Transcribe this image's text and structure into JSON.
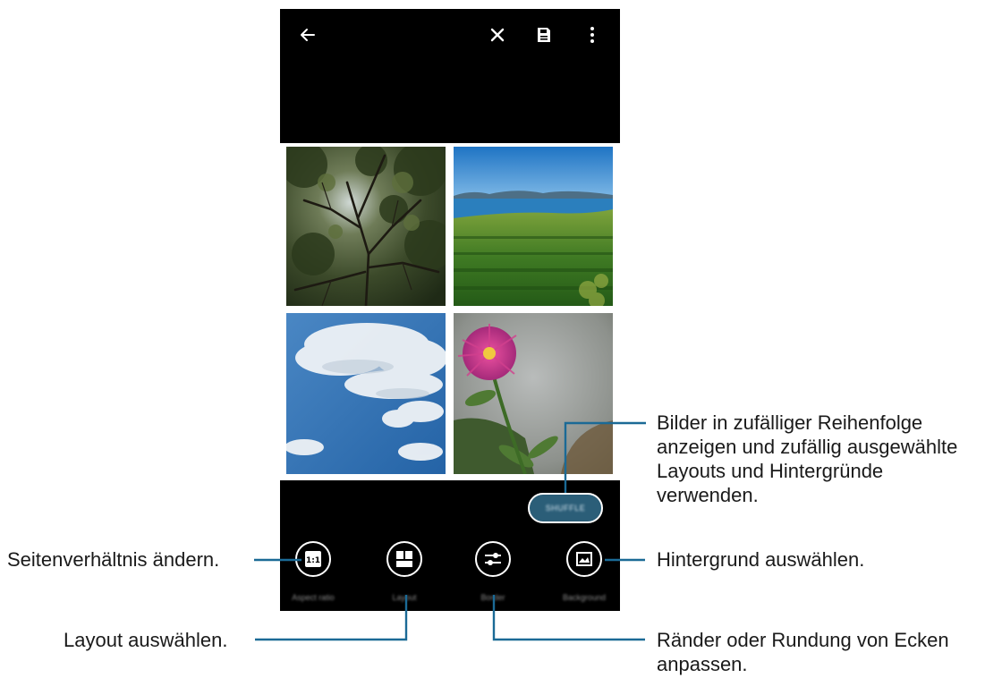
{
  "toolbar": {
    "back": "back-arrow-icon",
    "discard": "close-icon",
    "save": "save-icon",
    "more": "more-vertical-icon"
  },
  "collage": {
    "images": [
      "tree-canopy-photo",
      "sea-and-field-photo",
      "sky-clouds-photo",
      "purple-flower-photo"
    ]
  },
  "shuffle": {
    "label": "SHUFFLE"
  },
  "tools": [
    {
      "label": "Aspect ratio",
      "icon": "aspect-ratio-icon"
    },
    {
      "label": "Layout",
      "icon": "layout-icon"
    },
    {
      "label": "Border",
      "icon": "border-adjust-icon"
    },
    {
      "label": "Background",
      "icon": "background-icon"
    }
  ],
  "annotations": {
    "shuffle": [
      "Bilder in zufälliger Reihenfolge",
      "anzeigen und zufällig ausgewählte",
      "Layouts und Hintergründe",
      "verwenden."
    ],
    "aspect_ratio": "Seitenverhältnis ändern.",
    "background": "Hintergrund auswählen.",
    "layout": "Layout auswählen.",
    "border": [
      "Ränder oder Rundung von Ecken",
      "anpassen."
    ]
  },
  "colors": {
    "callout_line": "#1b6a96",
    "shuffle_button": "#2b5e78"
  }
}
